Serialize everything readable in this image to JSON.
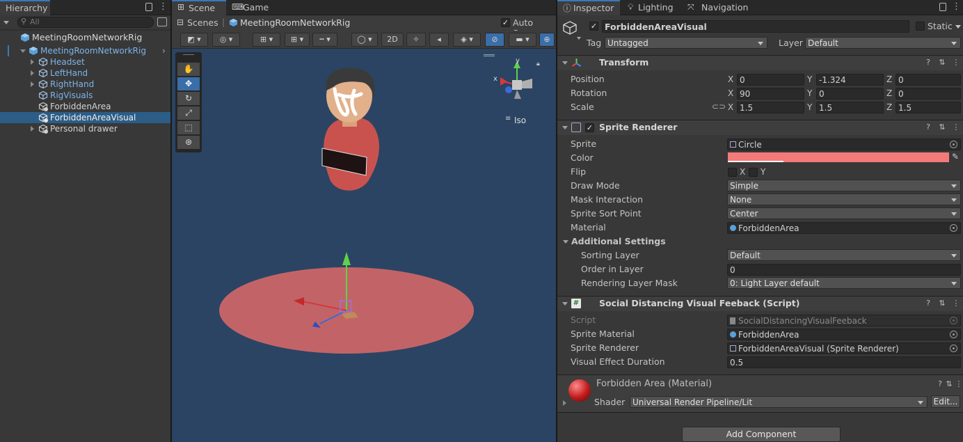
{
  "hierarchy": {
    "title": "Hierarchy",
    "search_placeholder": "All",
    "scene_root": "MeetingRoomNetworkRig",
    "items": [
      {
        "label": "MeetingRoomNetworkRig"
      },
      {
        "label": "Headset"
      },
      {
        "label": "LeftHand"
      },
      {
        "label": "RightHand"
      },
      {
        "label": "RigVisuals"
      },
      {
        "label": "ForbiddenArea"
      },
      {
        "label": "ForbiddenAreaVisual"
      },
      {
        "label": "Personal drawer"
      }
    ]
  },
  "scene": {
    "tab_scene": "Scene",
    "tab_game": "Game",
    "breadcrumb_scenes": "Scenes",
    "breadcrumb_prefab": "MeetingRoomNetworkRig",
    "auto_save": "Auto Save",
    "btn_2d": "2D",
    "gizmo_y": "y",
    "gizmo_x": "x",
    "iso": "Iso"
  },
  "inspector": {
    "tab_inspector": "Inspector",
    "tab_lighting": "Lighting",
    "tab_navigation": "Navigation",
    "object_name": "ForbiddenAreaVisual",
    "static_label": "Static",
    "tag_label": "Tag",
    "tag_value": "Untagged",
    "layer_label": "Layer",
    "layer_value": "Default",
    "transform": {
      "title": "Transform",
      "position_label": "Position",
      "rotation_label": "Rotation",
      "scale_label": "Scale",
      "position": {
        "x": "0",
        "y": "-1.324",
        "z": "0"
      },
      "rotation": {
        "x": "90",
        "y": "0",
        "z": "0"
      },
      "scale": {
        "x": "1.5",
        "y": "1.5",
        "z": "1.5"
      },
      "x": "X",
      "y": "Y",
      "z": "Z"
    },
    "sprite_renderer": {
      "title": "Sprite Renderer",
      "sprite_label": "Sprite",
      "sprite_value": "Circle",
      "color_label": "Color",
      "color_value": "#f47a7a",
      "flip_label": "Flip",
      "flip_x": "X",
      "flip_y": "Y",
      "draw_mode_label": "Draw Mode",
      "draw_mode_value": "Simple",
      "mask_label": "Mask Interaction",
      "mask_value": "None",
      "sort_point_label": "Sprite Sort Point",
      "sort_point_value": "Center",
      "material_label": "Material",
      "material_value": "ForbiddenArea",
      "additional": "Additional Settings",
      "sorting_layer_label": "Sorting Layer",
      "sorting_layer_value": "Default",
      "order_label": "Order in Layer",
      "order_value": "0",
      "rendering_mask_label": "Rendering Layer Mask",
      "rendering_mask_value": "0: Light Layer default"
    },
    "script": {
      "title": "Social Distancing Visual Feeback (Script)",
      "script_label": "Script",
      "script_value": "SocialDistancingVisualFeeback",
      "sprite_material_label": "Sprite Material",
      "sprite_material_value": "ForbiddenArea",
      "sprite_renderer_label": "Sprite Renderer",
      "sprite_renderer_value": "ForbiddenAreaVisual (Sprite Renderer)",
      "duration_label": "Visual Effect Duration",
      "duration_value": "0.5"
    },
    "material": {
      "title": "Forbidden Area (Material)",
      "shader_label": "Shader",
      "shader_value": "Universal Render Pipeline/Lit",
      "edit": "Edit..."
    },
    "add_component": "Add Component"
  }
}
